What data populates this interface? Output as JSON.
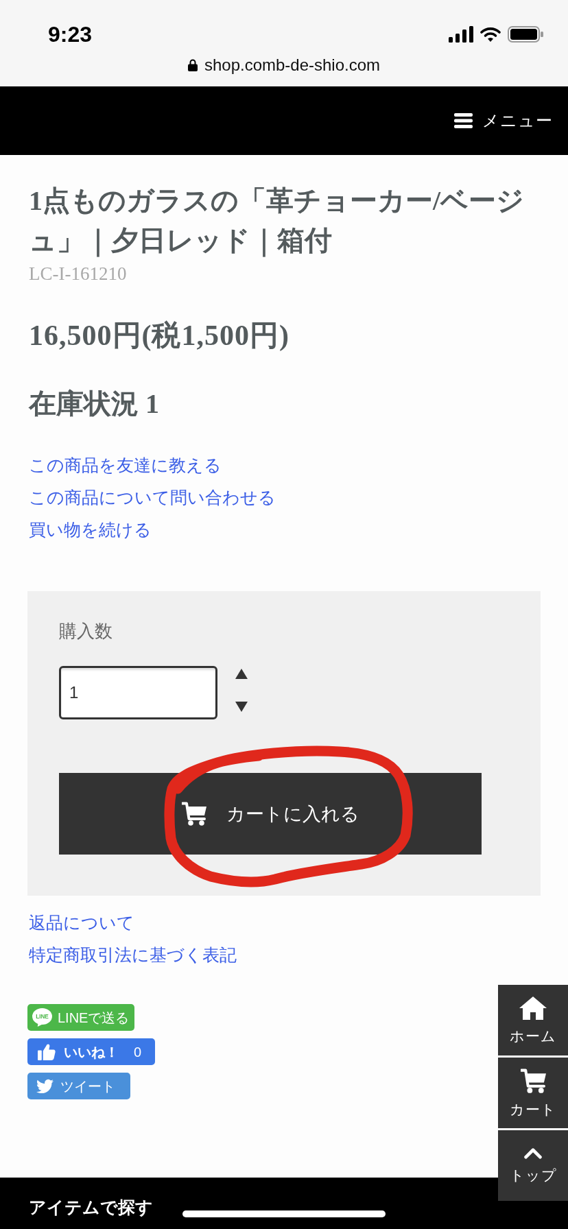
{
  "status_bar": {
    "time": "9:23"
  },
  "address_bar": {
    "url": "shop.comb-de-shio.com"
  },
  "header": {
    "menu_label": "メニュー"
  },
  "product": {
    "title": "1点ものガラスの「革チョーカー/ベージュ」｜夕日レッド｜箱付",
    "sku": "LC-I-161210",
    "price": "16,500円(税1,500円)",
    "stock": "在庫状況 1"
  },
  "product_links": [
    "この商品を友達に教える",
    "この商品について問い合わせる",
    "買い物を続ける"
  ],
  "purchase": {
    "quantity_label": "購入数",
    "quantity": "1",
    "add_to_cart_label": "カートに入れる"
  },
  "annotations": [
    {
      "kind": "circle"
    }
  ],
  "info_links": [
    "返品について",
    "特定商取引法に基づく表記"
  ],
  "share_buttons": [
    {
      "kind": "line",
      "logo": "LINE",
      "label": "LINEで送る"
    },
    {
      "kind": "like",
      "label": "いいね！",
      "count": "0"
    },
    {
      "kind": "tweet",
      "label": "ツイート"
    }
  ],
  "floating_nav": [
    {
      "kind": "home",
      "label": "ホーム"
    },
    {
      "kind": "cart",
      "label": "カート"
    },
    {
      "kind": "top",
      "label": "トップ"
    }
  ],
  "footer": {
    "title": "アイテムで探す"
  }
}
